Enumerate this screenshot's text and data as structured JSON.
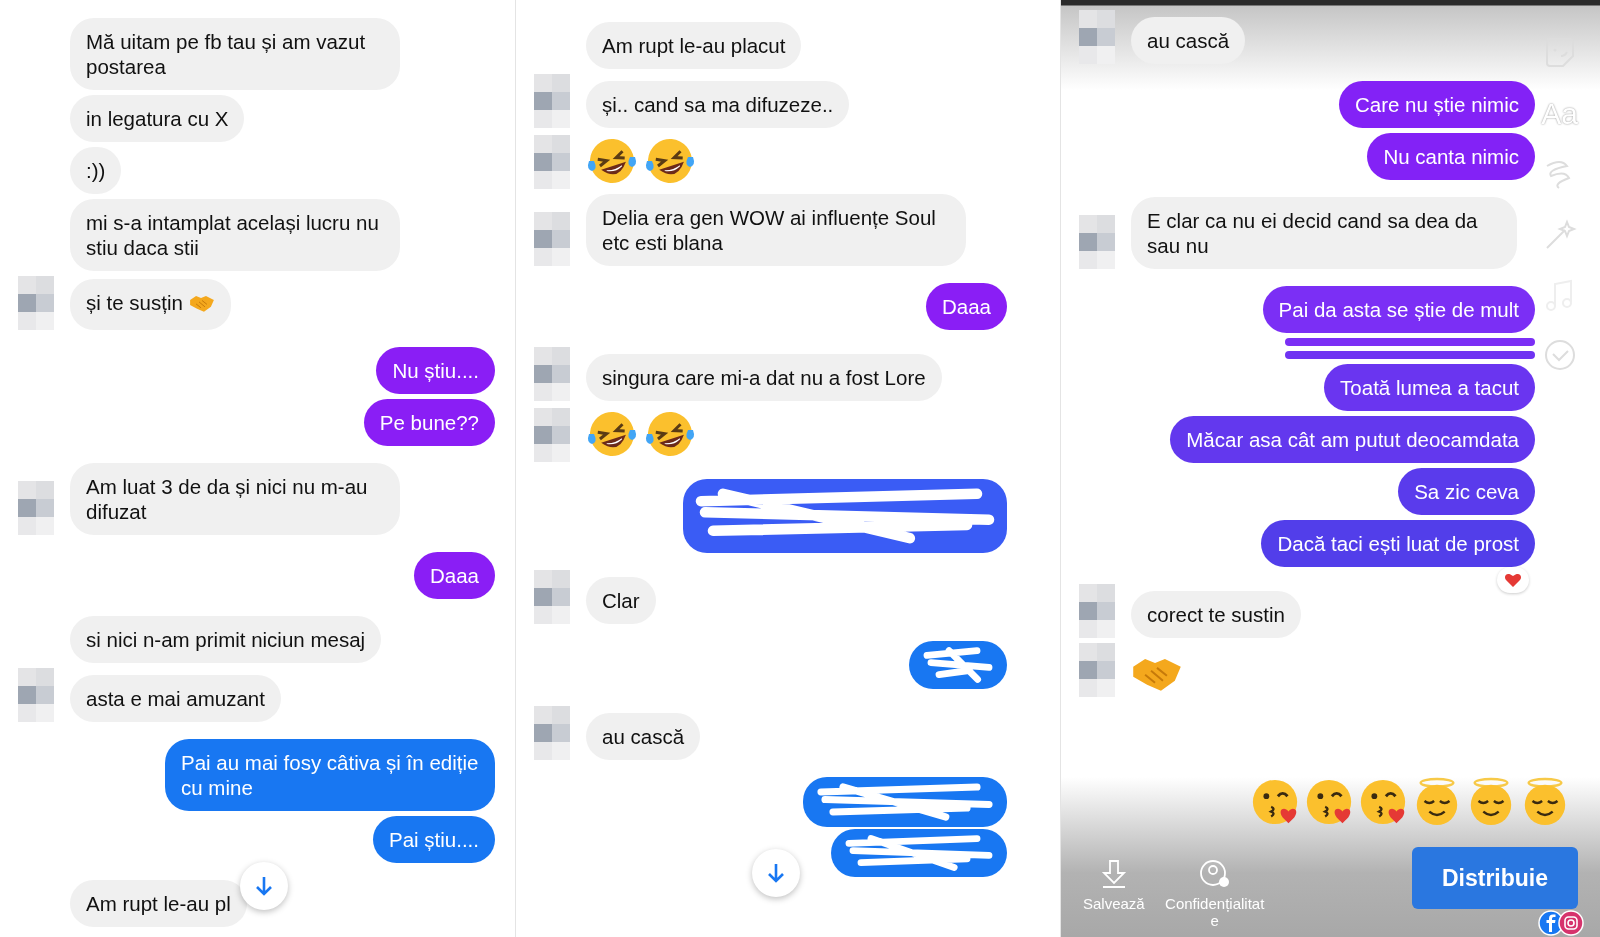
{
  "columns": [
    {
      "groups": [
        {
          "kind": "incoming",
          "messages": [
            {
              "kind": "text",
              "text": "Mă uitam pe fb tau și am vazut postarea",
              "avatar": false
            },
            {
              "kind": "text",
              "text": "in legatura cu X",
              "avatar": false
            },
            {
              "kind": "text",
              "text": ":))",
              "avatar": false
            },
            {
              "kind": "text",
              "text": "mi s-a intamplat același lucru nu stiu daca stii",
              "avatar": false
            },
            {
              "kind": "text",
              "text": "și te susțin",
              "trailing_emoji": {
                "kind": "handshake"
              },
              "avatar": true
            }
          ]
        },
        {
          "kind": "outgoing",
          "messages": [
            {
              "kind": "text",
              "text": "Nu știu....",
              "color": "#8a1ef5"
            },
            {
              "kind": "text",
              "text": "Pe bune??",
              "color": "#8a1ef5"
            }
          ]
        },
        {
          "kind": "incoming",
          "messages": [
            {
              "kind": "text",
              "text": "Am luat 3 de da și nici nu m-au difuzat",
              "avatar": true
            }
          ]
        },
        {
          "kind": "outgoing",
          "messages": [
            {
              "kind": "text",
              "text": "Daaa",
              "color": "#8a1ef5"
            }
          ]
        },
        {
          "kind": "incoming",
          "messages": [
            {
              "kind": "text",
              "text": "si nici n-am primit niciun mesaj",
              "avatar": false
            },
            {
              "kind": "text",
              "text": "asta e mai amuzant",
              "avatar": true
            }
          ]
        },
        {
          "kind": "outgoing",
          "messages": [
            {
              "kind": "text",
              "text": "Pai au mai fosy câtiva și în ediție cu mine",
              "color": "#1877f2"
            },
            {
              "kind": "text",
              "text": "Pai știu....",
              "color": "#1877f2"
            }
          ]
        },
        {
          "kind": "incoming",
          "messages": [
            {
              "kind": "text",
              "text": "Am rupt le-au pl",
              "avatar": false
            }
          ]
        }
      ],
      "scroll_button": true
    },
    {
      "groups": [
        {
          "kind": "incoming",
          "messages": [
            {
              "kind": "text",
              "text": "Am rupt le-au placut",
              "avatar": false
            },
            {
              "kind": "text",
              "text": "și.. cand sa ma difuzeze..",
              "avatar": true
            },
            {
              "kind": "emoji",
              "emojis": [
                {
                  "kind": "laughing"
                },
                {
                  "kind": "laughing"
                }
              ],
              "avatar": true
            },
            {
              "kind": "text",
              "text": "Delia era gen WOW ai influențe Soul etc esti blana",
              "avatar": true
            }
          ]
        },
        {
          "kind": "outgoing",
          "messages": [
            {
              "kind": "text",
              "text": "Daaa",
              "color": "#8a1ef5"
            }
          ]
        },
        {
          "kind": "incoming",
          "messages": [
            {
              "kind": "text",
              "text": "singura care mi-a dat nu a fost Lore",
              "avatar": true
            },
            {
              "kind": "emoji",
              "emojis": [
                {
                  "kind": "laughing"
                },
                {
                  "kind": "laughing"
                }
              ],
              "avatar": true
            }
          ]
        },
        {
          "kind": "outgoing",
          "messages": [
            {
              "kind": "redacted_wide",
              "color": "#3a5cf5"
            }
          ]
        },
        {
          "kind": "incoming",
          "messages": [
            {
              "kind": "text",
              "text": "Clar",
              "avatar": true
            }
          ]
        },
        {
          "kind": "outgoing",
          "messages": [
            {
              "kind": "redacted_short",
              "color": "#1877f2"
            }
          ]
        },
        {
          "kind": "incoming",
          "messages": [
            {
              "kind": "text",
              "text": "au cască",
              "avatar": true
            }
          ]
        },
        {
          "kind": "outgoing",
          "messages": [
            {
              "kind": "redacted_double",
              "color": "#1877f2"
            }
          ]
        }
      ],
      "scroll_button": true
    },
    {
      "groups": [
        {
          "kind": "incoming",
          "messages": [
            {
              "kind": "text",
              "text": "au cască",
              "avatar": true
            }
          ]
        },
        {
          "kind": "outgoing",
          "messages": [
            {
              "kind": "text",
              "text": "Care nu știe nimic",
              "color": "#8322f6"
            },
            {
              "kind": "text",
              "text": "Nu canta nimic",
              "color": "#8322f6"
            }
          ]
        },
        {
          "kind": "incoming",
          "messages": [
            {
              "kind": "text",
              "text": "E clar ca nu ei decid cand sa dea da sau nu",
              "avatar": true
            }
          ]
        },
        {
          "kind": "outgoing",
          "messages": [
            {
              "kind": "text",
              "text": "Pai da asta se știe de mult",
              "color": "#7b2ff5"
            },
            {
              "kind": "sliver",
              "color": "#7b2ff5"
            },
            {
              "kind": "sliver",
              "color": "#6f33f2"
            },
            {
              "kind": "text",
              "text": "Toată lumea a tacut",
              "color": "#6a35f0"
            },
            {
              "kind": "text",
              "text": "Măcar asa cât am putut deocamdata",
              "color": "#6338ee"
            },
            {
              "kind": "text",
              "text": "Sa zic ceva",
              "color": "#5a3bec"
            },
            {
              "kind": "text",
              "text": "Dacă taci ești luat de prost",
              "color": "#523eea",
              "reaction": {
                "kind": "heart"
              }
            }
          ]
        },
        {
          "kind": "incoming",
          "messages": [
            {
              "kind": "text",
              "text": "corect te sustin",
              "avatar": true
            },
            {
              "kind": "emoji",
              "emojis": [
                {
                  "kind": "handshake"
                }
              ],
              "avatar": true
            }
          ]
        }
      ],
      "editor": {
        "tools": [
          {
            "kind": "sticker"
          },
          {
            "kind": "text",
            "label": "Aa"
          },
          {
            "kind": "squiggle"
          },
          {
            "kind": "wand"
          },
          {
            "kind": "music"
          },
          {
            "kind": "check"
          }
        ],
        "emoji_bar": [
          {
            "kind": "kiss"
          },
          {
            "kind": "kiss"
          },
          {
            "kind": "kiss"
          },
          {
            "kind": "halo"
          },
          {
            "kind": "halo"
          },
          {
            "kind": "halo"
          }
        ],
        "actions": [
          {
            "kind": "save",
            "label": "Salvează"
          },
          {
            "kind": "privacy",
            "label": "Confidențialitate"
          }
        ],
        "share_button": "Distribuie"
      }
    }
  ]
}
